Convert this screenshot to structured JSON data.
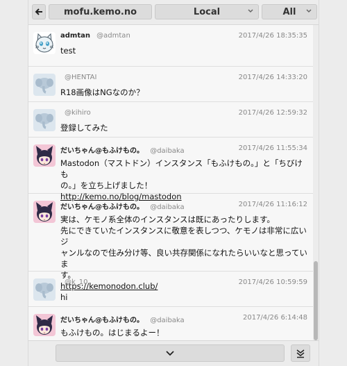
{
  "topbar": {
    "instance": "mofu.kemo.no",
    "timeline": "Local",
    "filter": "All"
  },
  "icons": {
    "back": "left-arrow-icon",
    "dropdown": "chevron-down-icon",
    "load_more": "chevron-down-icon",
    "scroll_bottom": "double-chevron-down-icon"
  },
  "colors": {
    "link": "#111111",
    "meta": "#888888",
    "button": "#dcdcdc"
  },
  "posts": [
    {
      "display_name": "admtan",
      "handle": "@admtan",
      "time": "2017/4/26 18:35:35",
      "lines": [
        "test"
      ],
      "link": "",
      "avatar": "cat-mascot"
    },
    {
      "display_name": "",
      "handle": "@HENTAI",
      "time": "2017/4/26 14:33:20",
      "lines": [
        "R18画像はNGなのか？"
      ],
      "link": "",
      "avatar": "default-elephant"
    },
    {
      "display_name": "",
      "handle": "@kihiro",
      "time": "2017/4/26 12:59:32",
      "lines": [
        "登録してみた"
      ],
      "link": "",
      "avatar": "default-elephant"
    },
    {
      "display_name": "だいちゃん@もふけもの。",
      "handle": "@daibaka",
      "time": "2017/4/26 11:55:34",
      "lines": [
        "Mastodon（マストドン）インスタンス「もふけもの。」と「ちびけも",
        "の。」を立ち上げました！"
      ],
      "link": "http://kemo.no/blog/mastodon",
      "avatar": "anime-character"
    },
    {
      "display_name": "だいちゃん@もふけもの。",
      "handle": "@daibaka",
      "time": "2017/4/26 11:16:12",
      "lines": [
        "実は、ケモノ系全体のインスタンスは既にあったりします。",
        "先にできていたインスタンスに敬意を表しつつ、ケモノは非常に広いジ",
        "ャンルなので住み分け等、良い共存関係になれたらいいなと思っていま",
        "す。"
      ],
      "link": "https://kemonodon.club/",
      "avatar": "anime-character"
    },
    {
      "display_name": "",
      "handle": "@k_10",
      "time": "2017/4/26 10:59:59",
      "lines": [
        "hi"
      ],
      "link": "",
      "avatar": "default-elephant"
    },
    {
      "display_name": "だいちゃん@もふけもの。",
      "handle": "@daibaka",
      "time": "2017/4/26 6:14:48",
      "lines": [
        "もふけもの。はじまるよー！"
      ],
      "link": "",
      "avatar": "anime-character"
    }
  ]
}
